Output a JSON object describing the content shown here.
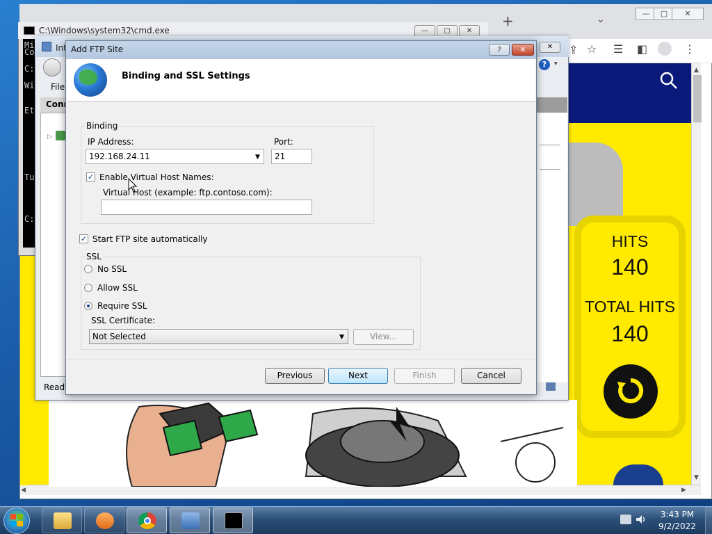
{
  "cmd_window": {
    "title": "C:\\Windows\\system32\\cmd.exe",
    "lines": [
      "Mi",
      "Co",
      "C:",
      "Wi",
      "Et",
      "Tu",
      "C:"
    ]
  },
  "iis_window": {
    "title": "Int",
    "menu_file": "File",
    "connections": "Conn",
    "status": "Ready"
  },
  "dialog": {
    "title": "Add FTP Site",
    "help_label": "?",
    "close_label": "✕",
    "heading": "Binding and SSL Settings",
    "binding": {
      "group_label": "Binding",
      "ip_label": "IP Address:",
      "ip_value": "192.168.24.11",
      "port_label": "Port:",
      "port_value": "21",
      "virtual_host_check_label": "Enable Virtual Host Names:",
      "virtual_host_checked": true,
      "virtual_host_label": "Virtual Host (example: ftp.contoso.com):",
      "virtual_host_value": ""
    },
    "start_auto_label": "Start FTP site automatically",
    "start_auto_checked": true,
    "ssl": {
      "group_label": "SSL",
      "options": [
        "No SSL",
        "Allow SSL",
        "Require SSL"
      ],
      "selected": "Require SSL",
      "cert_label": "SSL Certificate:",
      "cert_value": "Not Selected",
      "view_label": "View..."
    },
    "buttons": {
      "previous": "Previous",
      "next": "Next",
      "finish": "Finish",
      "cancel": "Cancel"
    }
  },
  "site": {
    "hits_label": "HITS",
    "hits_value": "140",
    "total_hits_label": "TOTAL HITS",
    "total_hits_value": "140"
  },
  "chrome": {
    "new_tab": "+",
    "minimize": "—",
    "maximize": "▢",
    "close": "✕"
  },
  "taskbar": {
    "time": "3:43 PM",
    "date": "9/2/2022",
    "apps": [
      "explorer",
      "media-player",
      "chrome",
      "iis-manager",
      "cmd"
    ]
  },
  "colors": {
    "site_yellow": "#ffea00",
    "site_navy": "#0a1a7a",
    "dialog_bg": "#f0f0f0"
  }
}
